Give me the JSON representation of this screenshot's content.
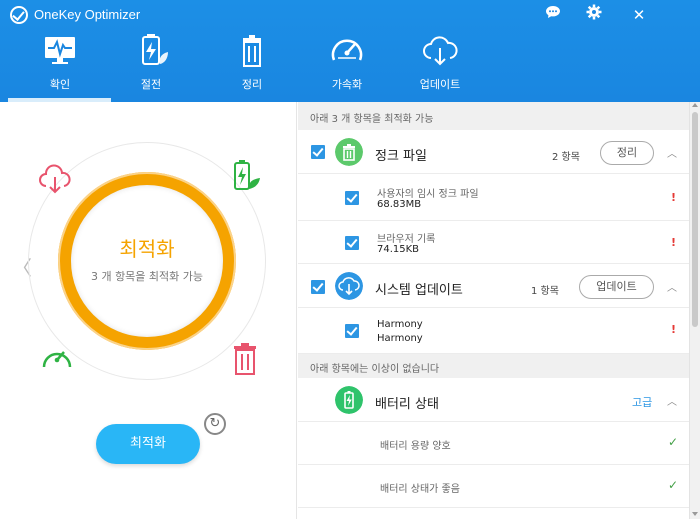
{
  "app": {
    "title": "OneKey Optimizer"
  },
  "window": {
    "chat_icon": "chat-icon",
    "settings_icon": "gear-icon",
    "close_glyph": "✕"
  },
  "tabs": [
    {
      "label": "확인",
      "icon": "monitor-pulse-icon",
      "active": true
    },
    {
      "label": "절전",
      "icon": "battery-leaf-icon"
    },
    {
      "label": "정리",
      "icon": "trash-icon"
    },
    {
      "label": "가속화",
      "icon": "speedometer-icon"
    },
    {
      "label": "업데이트",
      "icon": "cloud-download-icon"
    }
  ],
  "left": {
    "ring_title": "최적화",
    "ring_subtitle": "3 개 항목을 최적화 가능",
    "optimize_button": "최적화",
    "refresh_glyph": "↻",
    "prev_glyph": "〈"
  },
  "right": {
    "section1_header": "아래 3 개 항목을 최적화 가능",
    "junk": {
      "title": "정크 파일",
      "count": "2 항목",
      "action": "정리",
      "items": [
        {
          "name": "사용자의 임시 정크 파일",
          "value": "68.83MB"
        },
        {
          "name": "브라우저 기록",
          "value": "74.15KB"
        }
      ]
    },
    "update": {
      "title": "시스템 업데이트",
      "count": "1 항목",
      "action": "업데이트",
      "items": [
        {
          "name": "Harmony",
          "value": "Harmony"
        }
      ]
    },
    "section2_header": "아래 항목에는 이상이 없습니다",
    "battery": {
      "title": "배터리 상태",
      "action": "고급",
      "items": [
        {
          "name": "배터리 용량 양호"
        },
        {
          "name": "배터리 상태가 좋음"
        }
      ]
    },
    "warn_glyph": "!",
    "ok_glyph": "✓",
    "caret_glyph": "︿"
  },
  "colors": {
    "header": "#1a86e0",
    "accent": "#2d96e3",
    "ring": "#f5a300",
    "button": "#29b6f6",
    "warning": "#e53935",
    "ok": "#43a047"
  }
}
